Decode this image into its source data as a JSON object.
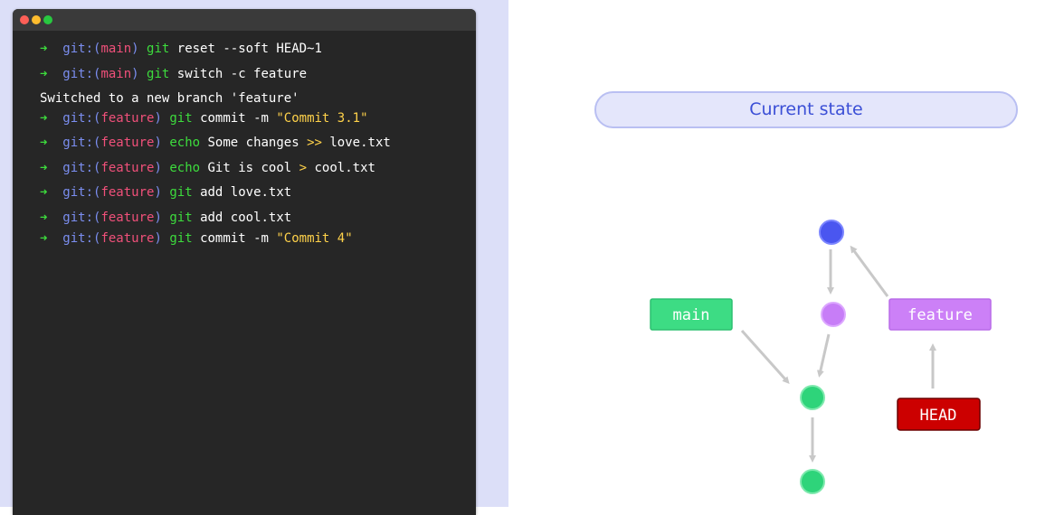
{
  "terminal": {
    "prompt_arrow": "➜",
    "lines": [
      {
        "git": "git:(",
        "branch": "main",
        "close": ")",
        "cmd": "git",
        "rest": " reset --soft HEAD~1"
      },
      {
        "git": "git:(",
        "branch": "main",
        "close": ")",
        "cmd": "git",
        "rest": " switch -c feature"
      },
      {
        "output": "Switched to a new branch 'feature'"
      },
      {
        "git": "git:(",
        "branch": "feature",
        "close": ")",
        "cmd": "git",
        "rest": " commit -m ",
        "string": "\"Commit 3.1\""
      },
      {
        "git": "git:(",
        "branch": "feature",
        "close": ")",
        "cmd": "echo",
        "rest": " Some changes ",
        "op": ">>",
        "rest2": " love.txt"
      },
      {
        "git": "git:(",
        "branch": "feature",
        "close": ")",
        "cmd": "echo",
        "rest": " Git is cool ",
        "op": ">",
        "rest2": " cool.txt"
      },
      {
        "git": "git:(",
        "branch": "feature",
        "close": ")",
        "cmd": "git",
        "rest": " add love.txt"
      },
      {
        "git": "git:(",
        "branch": "feature",
        "close": ")",
        "cmd": "git",
        "rest": " add cool.txt"
      },
      {
        "git": "git:(",
        "branch": "feature",
        "close": ")",
        "cmd": "git",
        "rest": " commit -m ",
        "string": "\"Commit 4\""
      }
    ]
  },
  "diagram": {
    "title": "Current state",
    "labels": {
      "main": "main",
      "feature": "feature",
      "head": "HEAD"
    },
    "colors": {
      "commit_blue": "#4a56f0",
      "commit_purple": "#c77df7",
      "commit_green": "#2ed47a",
      "main_label": "#3ddc84",
      "feature_label": "#cc80f7",
      "head_label": "#cc0000",
      "arrow": "#c8c8c8"
    }
  }
}
